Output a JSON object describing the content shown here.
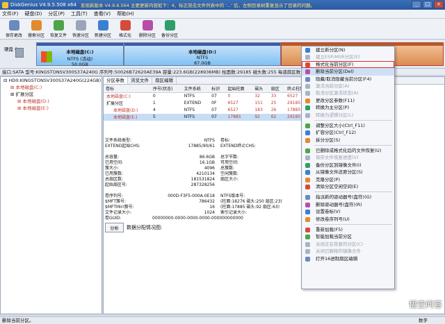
{
  "titlebar": {
    "title": "DiskGenius V4.9.5.508 x64",
    "notice": "发现新版本 V4.9.6.564 主要更新内容如下：4、标正双击文件列表中的 '...' 后，左侧目录树重复显示了目录的问题。"
  },
  "menu": [
    "文件(F)",
    "硬盘(D)",
    "分区(P)",
    "工具(T)",
    "查看(V)",
    "帮助(H)"
  ],
  "toolbar": [
    {
      "label": "保存更改",
      "color": "#6a8bbd"
    },
    {
      "label": "搜索分区",
      "color": "#e08b2c"
    },
    {
      "label": "恢复文件",
      "color": "#4fa44a"
    },
    {
      "label": "快速分区",
      "color": "#9aa6b8"
    },
    {
      "label": "新建分区",
      "color": "#3b7fd0"
    },
    {
      "label": "格式化",
      "color": "#d64a3a"
    },
    {
      "label": "删除分区",
      "color": "#b84da9"
    },
    {
      "label": "备份分区",
      "color": "#2f9d6a"
    }
  ],
  "disk": {
    "label_top": "硬盘 0",
    "parts": [
      {
        "name": "本地磁盘(C:)",
        "fs": "NTFS (活动)",
        "size": "50.0GB"
      },
      {
        "name": "本地磁盘(D:)",
        "fs": "NTFS",
        "size": "87.0GB"
      },
      {
        "name": "",
        "fs": "",
        "size": ""
      }
    ],
    "info": "接口:SATA  型号:KINGSTONSV300S37A240G  序列号:50026B72620AE39A  容量:223.6GB(228936MB)  柱面数:29185  磁头数:255  每道扇区数:63  总扇区数:468862128"
  },
  "tree": [
    {
      "text": "HD0:KINGSTONSV300S37A240G(224GB)",
      "cls": ""
    },
    {
      "text": "本地磁盘(C:)",
      "cls": "hl"
    },
    {
      "text": "扩展分区",
      "cls": ""
    },
    {
      "text": "本地磁盘(D:)",
      "cls": "hl"
    },
    {
      "text": "本地磁盘(E:)",
      "cls": "hl"
    }
  ],
  "tabs": [
    "分区参数",
    "浏览文件",
    "扇区编辑"
  ],
  "table": {
    "headers": [
      "卷标",
      "序号(状态)",
      "文件系统",
      "标识",
      "起始柱面",
      "磁头",
      "扇区",
      "终止柱面"
    ],
    "rows": [
      [
        "本地磁盘(C:)",
        "0",
        "NTFS",
        "07",
        "0",
        "32",
        "33",
        "6527"
      ],
      [
        "扩展分区",
        "1",
        "EXTEND",
        "0F",
        "6527",
        "151",
        "25",
        "29185"
      ],
      [
        "本地磁盘(D:)",
        "4",
        "NTFS",
        "07",
        "6527",
        "183",
        "26",
        "17885"
      ],
      [
        "本地磁盘(E:)",
        "5",
        "NTFS",
        "07",
        "17885",
        "92",
        "62",
        "29185"
      ]
    ]
  },
  "details": [
    [
      "文件系统类型:",
      "NTFS",
      "卷标:",
      ""
    ],
    [
      "EXTEND起始CHS:",
      "17885/90/61",
      "EXTEND终止CHS:",
      ""
    ],
    [
      "",
      "",
      " ",
      ""
    ],
    [
      "总容量:",
      "86.6GB",
      "总字节数:",
      ""
    ],
    [
      "已用空间:",
      "16.1GB",
      "可用空间:",
      ""
    ],
    [
      "簇大小:",
      "4096",
      "总簇数:",
      ""
    ],
    [
      "已用簇数:",
      "4210134",
      "空闲簇数:",
      ""
    ],
    [
      "总扇区数:",
      "181531824",
      "扇区大小:",
      ""
    ],
    [
      "起始扇区号:",
      "287328256",
      "",
      ""
    ],
    [
      "",
      "",
      " ",
      ""
    ],
    [
      "卷序列号:",
      "000D-F3F5-000A-0E18",
      "NTFS版本号:",
      ""
    ],
    [
      "$MFT簇号:",
      "786432",
      "(柱面:18276 磁头:250 扇区:23)",
      ""
    ],
    [
      "$MFTMirr簇号:",
      "16",
      "(柱面:17885 磁头:92 扇区:63)",
      ""
    ],
    [
      "文件记录大小:",
      "1024",
      "索引记录大小:",
      ""
    ],
    [
      "卷GUID:",
      "00000000-0000-0000-0000-000000000000",
      "",
      ""
    ]
  ],
  "analyze": {
    "button": "分析",
    "caption": "数据分配情况图:"
  },
  "context_menu": [
    {
      "label": "建立新分区(N)",
      "dis": false,
      "c": "#3b7fd0"
    },
    {
      "label": "建立ESP/MSR分区(E)",
      "dis": true,
      "c": "#aab3c2"
    },
    {
      "label": "格式化当前分区(F)",
      "dis": false,
      "c": "#d64a3a",
      "boxed": true
    },
    {
      "label": "删除当前分区(Del)",
      "dis": false,
      "c": "#b84da9",
      "hover": true
    },
    {
      "label": "隐藏/取消隐藏当前分区(F4)",
      "dis": false,
      "c": "#6a8bbd"
    },
    {
      "label": "激活当前分区(A)",
      "dis": true,
      "c": "#aab3c2"
    },
    {
      "label": "取消分区激活状态(A)",
      "dis": true,
      "c": "#aab3c2"
    },
    {
      "label": "更改分区参数(F11)",
      "dis": false,
      "c": "#e08b2c"
    },
    {
      "label": "转换为主分区(P)",
      "dis": false,
      "c": "#2f9d6a"
    },
    {
      "label": "转换为逻辑分区(L)",
      "dis": true,
      "c": "#aab3c2"
    },
    {
      "sep": true
    },
    {
      "label": "调整分区大小(Ctrl_F11)",
      "dis": false,
      "c": "#4fa44a"
    },
    {
      "label": "扩容分区(Ctrl_F12)",
      "dis": false,
      "c": "#3b7fd0"
    },
    {
      "label": "拆分分区(S)",
      "dis": false,
      "c": "#e08b2c"
    },
    {
      "sep": true
    },
    {
      "label": "已删除或格式化后的文件恢复(U)",
      "dis": false,
      "c": "#4fa44a"
    },
    {
      "label": "保存文件恢复进度(V)",
      "dis": true,
      "c": "#aab3c2"
    },
    {
      "label": "备份分区到镜像文件(I)",
      "dis": false,
      "c": "#2f9d6a"
    },
    {
      "label": "从镜像文件还原分区(S)",
      "dis": false,
      "c": "#3b7fd0"
    },
    {
      "label": "克隆分区(P)",
      "dis": false,
      "c": "#e08b2c"
    },
    {
      "label": "清除分区空闲空间(E)",
      "dis": false,
      "c": "#d64a3a"
    },
    {
      "sep": true
    },
    {
      "label": "指派新的驱动器号(盘符)(G)",
      "dis": false,
      "c": "#6a8bbd"
    },
    {
      "label": "删除驱动器号(盘符)(R)",
      "dis": false,
      "c": "#b84da9"
    },
    {
      "label": "设置卷标(V)",
      "dis": false,
      "c": "#3b7fd0"
    },
    {
      "label": "修改卷序列号(U)",
      "dis": false,
      "c": "#e08b2c"
    },
    {
      "sep": true
    },
    {
      "label": "重新加载(F5)",
      "dis": false,
      "c": "#d64a3a"
    },
    {
      "label": "智能加载当前分区",
      "dis": false,
      "c": "#4fa44a"
    },
    {
      "label": "关闭正在恢复的分区(C)",
      "dis": true,
      "c": "#aab3c2"
    },
    {
      "label": "关闭已解释的镜像文件",
      "dis": true,
      "c": "#aab3c2"
    },
    {
      "label": "打开16进制扇区编辑",
      "dis": false,
      "c": "#6a8bbd"
    }
  ],
  "status": {
    "left": "删除当前分区。",
    "right": "数字"
  },
  "watermark": "悟空问答"
}
